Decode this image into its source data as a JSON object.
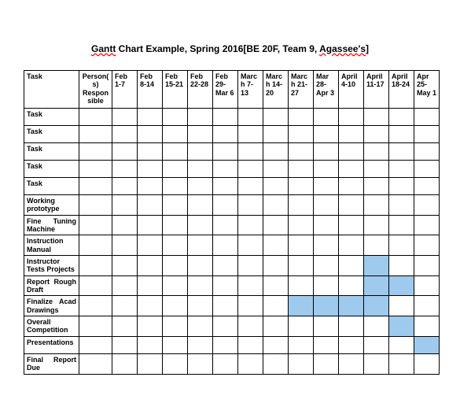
{
  "title_prefix": "Gantt",
  "title_rest": " Chart Example, Spring 2016[BE 20F, Team 9, ",
  "title_name": "Agassee's",
  "title_close": "]",
  "headers": {
    "task": "Task",
    "person": "Person(s) Responsible",
    "weeks": [
      "Feb 1-7",
      "Feb 8-14",
      "Feb 15-21",
      "Feb 22-28",
      "Feb 29-Mar 6",
      "March 7-13",
      "March 14-20",
      "March 21-27",
      "Mar 28-Apr 3",
      "April 4-10",
      "April 11-17",
      "April 18-24",
      "Apr 25-May 1"
    ]
  },
  "rows": [
    {
      "label": "Task",
      "cells": [
        0,
        0,
        0,
        0,
        0,
        0,
        0,
        0,
        0,
        0,
        0,
        0,
        0
      ]
    },
    {
      "label": "Task",
      "cells": [
        0,
        0,
        0,
        0,
        0,
        0,
        0,
        0,
        0,
        0,
        0,
        0,
        0
      ]
    },
    {
      "label": "Task",
      "cells": [
        0,
        0,
        0,
        0,
        0,
        0,
        0,
        0,
        0,
        0,
        0,
        0,
        0
      ]
    },
    {
      "label": "Task",
      "cells": [
        0,
        0,
        0,
        0,
        0,
        0,
        0,
        0,
        0,
        0,
        0,
        0,
        0
      ]
    },
    {
      "label": "Task",
      "cells": [
        0,
        0,
        0,
        0,
        0,
        0,
        0,
        0,
        0,
        0,
        0,
        0,
        0
      ]
    },
    {
      "label": "Working prototype",
      "cells": [
        0,
        0,
        0,
        0,
        0,
        0,
        0,
        0,
        0,
        0,
        0,
        0,
        0
      ]
    },
    {
      "label": "Fine Tuning Machine",
      "cells": [
        0,
        0,
        0,
        0,
        0,
        0,
        0,
        0,
        0,
        0,
        0,
        0,
        0
      ]
    },
    {
      "label": "Instruction Manual",
      "cells": [
        0,
        0,
        0,
        0,
        0,
        0,
        0,
        0,
        0,
        0,
        0,
        0,
        0
      ]
    },
    {
      "label": "Instructor Tests Projects",
      "cells": [
        0,
        0,
        0,
        0,
        0,
        0,
        0,
        0,
        0,
        0,
        1,
        0,
        0
      ]
    },
    {
      "label": "Report Rough Draft",
      "cells": [
        0,
        0,
        0,
        0,
        0,
        0,
        0,
        0,
        0,
        0,
        1,
        1,
        0
      ]
    },
    {
      "label": "Finalize Acad Drawings",
      "cells": [
        0,
        0,
        0,
        0,
        0,
        0,
        0,
        1,
        1,
        1,
        1,
        0,
        0
      ]
    },
    {
      "label": "Overall Competition",
      "cells": [
        0,
        0,
        0,
        0,
        0,
        0,
        0,
        0,
        0,
        0,
        0,
        1,
        0
      ]
    },
    {
      "label": "Presentations",
      "cells": [
        0,
        0,
        0,
        0,
        0,
        0,
        0,
        0,
        0,
        0,
        0,
        0,
        1
      ]
    },
    {
      "label": "Final Report Due",
      "cells": [
        0,
        0,
        0,
        0,
        0,
        0,
        0,
        0,
        0,
        0,
        0,
        0,
        0
      ]
    }
  ],
  "chart_data": {
    "type": "gantt",
    "title": "Gantt Chart Example, Spring 2016[BE 20F, Team 9, Agassee's]",
    "categories": [
      "Feb 1-7",
      "Feb 8-14",
      "Feb 15-21",
      "Feb 22-28",
      "Feb 29-Mar 6",
      "March 7-13",
      "March 14-20",
      "March 21-27",
      "Mar 28-Apr 3",
      "April 4-10",
      "April 11-17",
      "April 18-24",
      "Apr 25-May 1"
    ],
    "tasks": [
      {
        "name": "Task",
        "periods": []
      },
      {
        "name": "Task",
        "periods": []
      },
      {
        "name": "Task",
        "periods": []
      },
      {
        "name": "Task",
        "periods": []
      },
      {
        "name": "Task",
        "periods": []
      },
      {
        "name": "Working prototype",
        "periods": []
      },
      {
        "name": "Fine Tuning Machine",
        "periods": []
      },
      {
        "name": "Instruction Manual",
        "periods": []
      },
      {
        "name": "Instructor Tests Projects",
        "periods": [
          "April 11-17"
        ]
      },
      {
        "name": "Report Rough Draft",
        "periods": [
          "April 11-17",
          "April 18-24"
        ]
      },
      {
        "name": "Finalize Acad Drawings",
        "periods": [
          "March 21-27",
          "Mar 28-Apr 3",
          "April 4-10",
          "April 11-17"
        ]
      },
      {
        "name": "Overall Competition",
        "periods": [
          "April 18-24"
        ]
      },
      {
        "name": "Presentations",
        "periods": [
          "Apr 25-May 1"
        ]
      },
      {
        "name": "Final Report Due",
        "periods": []
      }
    ]
  }
}
